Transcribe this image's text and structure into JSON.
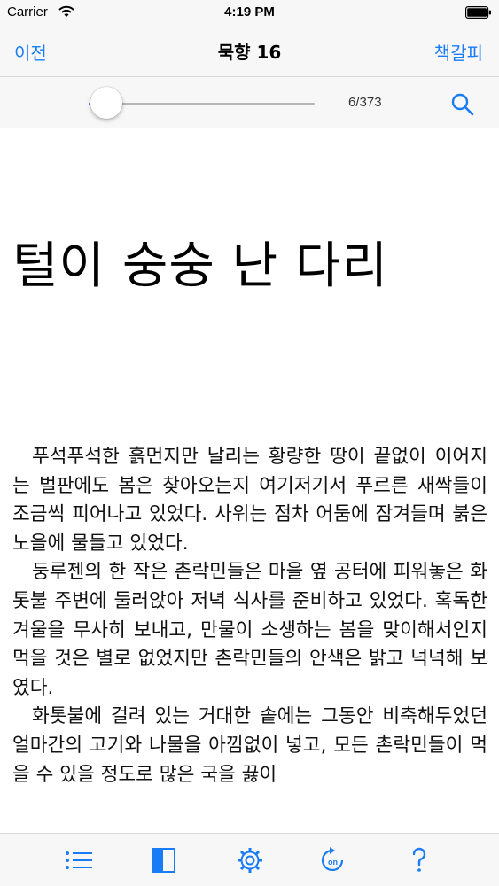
{
  "status_bar": {
    "carrier": "Carrier",
    "time": "4:19 PM"
  },
  "nav": {
    "back_label": "이전",
    "title": "묵향 16",
    "bookmark_label": "책갈피"
  },
  "reader": {
    "page_indicator": "6/373",
    "progress": 0.016
  },
  "content": {
    "chapter_title": "털이 숭숭 난 다리",
    "paragraphs": [
      "푸석푸석한 흙먼지만 날리는 황량한 땅이 끝없이 이어지는 벌판에도 봄은 찾아오는지 여기저기서 푸르른 새싹들이 조금씩 피어나고 있었다. 사위는 점차 어둠에 잠겨들며 붉은 노을에 물들고 있었다.",
      "둥루젠의 한 작은 촌락민들은 마을 옆 공터에 피워놓은 화톳불 주변에 둘러앉아 저녁 식사를 준비하고 있었다. 혹독한 겨울을 무사히 보내고, 만물이 소생하는 봄을 맞이해서인지 먹을 것은 별로 없었지만 촌락민들의 안색은 밝고 넉넉해 보였다.",
      "화톳불에 걸려 있는 거대한 솥에는 그동안 비축해두었던 얼마간의 고기와 나물을 아낌없이 넣고, 모든 촌락민들이 먹을 수 있을 정도로 많은 국을 끓이"
    ]
  },
  "colors": {
    "accent": "#1a7cf5",
    "bar_background": "#f7f7f8"
  },
  "icons": {
    "tab_bar": [
      "list-icon",
      "sidebar-icon",
      "gear-icon",
      "rotate-on-icon",
      "question-icon"
    ],
    "slider_bar": [
      "search-icon"
    ],
    "status_bar": [
      "wifi-icon",
      "battery-icon"
    ]
  }
}
